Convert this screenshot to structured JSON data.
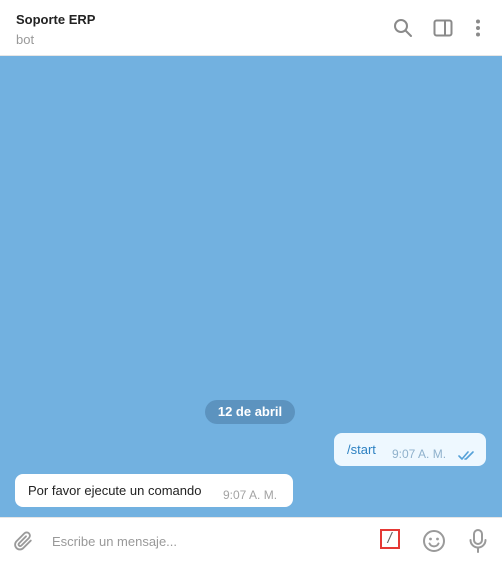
{
  "header": {
    "title": "Soporte ERP",
    "subtitle": "bot",
    "icons": [
      "search-icon",
      "sidebar-toggle-icon",
      "more-vertical-icon"
    ]
  },
  "chat": {
    "background_color": "#72b1e0",
    "date_separator": "12 de abril",
    "messages": [
      {
        "direction": "outgoing",
        "text": "/start",
        "time": "9:07 A. M.",
        "status": "read"
      },
      {
        "direction": "incoming",
        "text": "Por favor ejecute un comando",
        "time": "9:07 A. M."
      }
    ]
  },
  "composer": {
    "placeholder": "Escribe un mensaje...",
    "value": "",
    "command_button": "/",
    "icons": [
      "paperclip-icon",
      "slash-command-icon",
      "emoji-icon",
      "microphone-icon"
    ]
  },
  "colors": {
    "accent": "#2d81c2",
    "highlight_border": "#e53935"
  }
}
